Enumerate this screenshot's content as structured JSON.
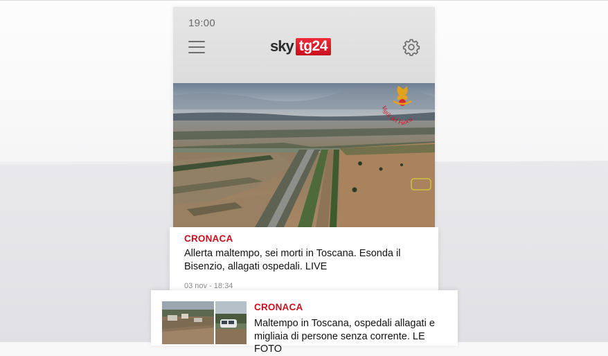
{
  "status_bar": {
    "time": "19:00"
  },
  "header": {
    "logo": {
      "sky": "sky",
      "tg": "tg24"
    },
    "menu_icon": "hamburger-menu-icon",
    "settings_icon": "gear-icon"
  },
  "hero": {
    "image": "aerial photo of flooded plain with highway",
    "watermark_text": "Vigili del Fuoco"
  },
  "articles": [
    {
      "category": "CRONACA",
      "headline": "Allerta maltempo, sei morti in Toscana. Esonda il Bisenzio, allagati ospedali. LIVE",
      "date": "03 nov - 18:34"
    },
    {
      "category": "CRONACA",
      "headline": "Maltempo in Toscana, ospedali allagati e migliaia di persone senza corrente. LE FOTO"
    }
  ],
  "colors": {
    "accent_red": "#c8101f",
    "header_bg": "#e2e2e2",
    "text_dark": "#111111",
    "text_muted": "#8a8a8a"
  }
}
